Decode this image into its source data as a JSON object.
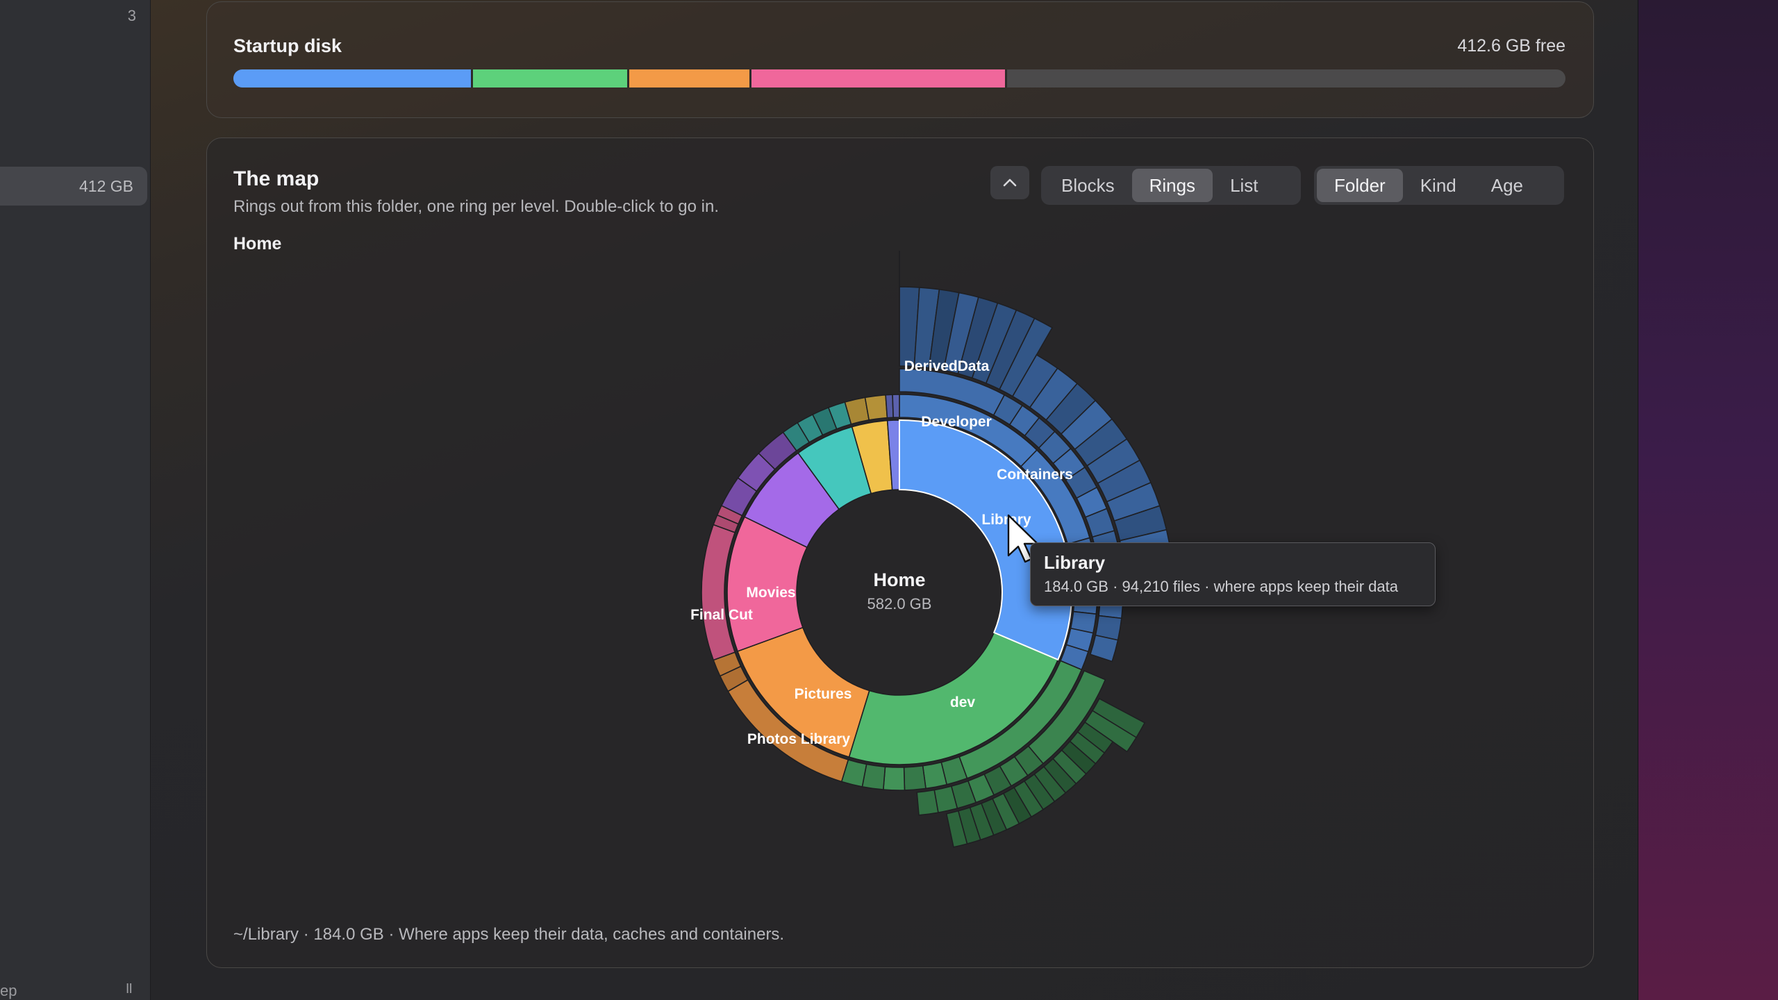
{
  "sidebar": {
    "top_count": "3",
    "selected_size": "412 GB",
    "footer_left": "ep",
    "footer_right": "II"
  },
  "disk": {
    "title": "Startup disk",
    "free_label": "412.6 GB free",
    "segments": [
      {
        "fraction": 0.18,
        "color": "#5b9cf6"
      },
      {
        "fraction": 0.117,
        "color": "#5dd17b"
      },
      {
        "fraction": 0.092,
        "color": "#f39a47"
      },
      {
        "fraction": 0.192,
        "color": "#f0679b"
      }
    ],
    "track_color": "#4b4a4b"
  },
  "map": {
    "title": "The map",
    "subtitle": "Rings out from this folder, one ring per level. Double-click to go in.",
    "breadcrumb": "Home",
    "view_options": [
      "Blocks",
      "Rings",
      "List"
    ],
    "view_selected": "Rings",
    "group_options": [
      "Folder",
      "Kind",
      "Age"
    ],
    "group_selected": "Folder",
    "up_icon": "chevron-up-icon",
    "status": "~/Library · 184.0 GB · Where apps keep their data, caches and containers."
  },
  "sunburst": {
    "center_title": "Home",
    "center_size": "582.0 GB",
    "labels": {
      "library": "Library",
      "containers": "Containers",
      "developer": "Developer",
      "deriveddata": "DerivedData",
      "dev": "dev",
      "pictures": "Pictures",
      "photos_library": "Photos Library",
      "movies": "Movies",
      "final_cut": "Final Cut"
    },
    "colors": {
      "library": "#5b9cf6",
      "dev": "#52b86e",
      "pictures": "#f39a47",
      "movies": "#f0679b",
      "purple": "#a46ae8",
      "teal": "#45c7bd",
      "gold": "#f0c14b",
      "indigo": "#7a82e8"
    }
  },
  "tooltip": {
    "title": "Library",
    "detail": "184.0 GB · 94,210 files · where apps keep their data"
  }
}
